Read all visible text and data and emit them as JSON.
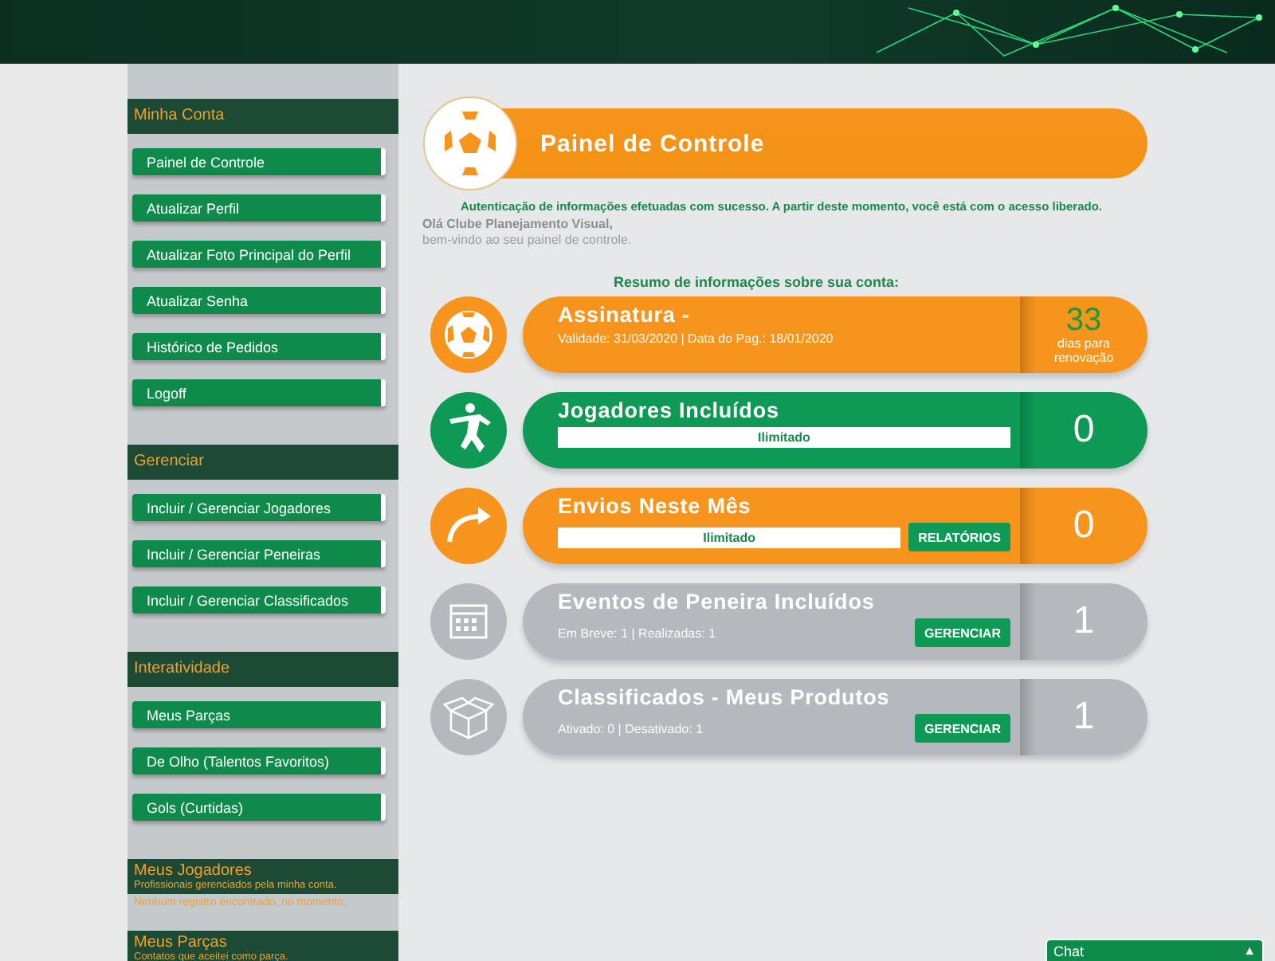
{
  "sidebar": {
    "sections": [
      {
        "heading": "Minha Conta",
        "items": [
          "Painel de Controle",
          "Atualizar Perfil",
          "Atualizar Foto Principal do Perfil",
          "Atualizar Senha",
          "Histórico de Pedidos",
          "Logoff"
        ]
      },
      {
        "heading": "Gerenciar",
        "items": [
          "Incluir / Gerenciar Jogadores",
          "Incluir / Gerenciar Peneiras",
          "Incluir / Gerenciar Classificados"
        ]
      },
      {
        "heading": "Interatividade",
        "items": [
          "Meus Parças",
          "De Olho (Talentos Favoritos)",
          "Gols (Curtidas)"
        ]
      }
    ],
    "panels": [
      {
        "heading": "Meus Jogadores",
        "subtitle": "Profissionais gerenciados pela minha conta.",
        "message": "Nenhum registro encontrado, no momento."
      },
      {
        "heading": "Meus Parças",
        "subtitle": "Contatos que aceitei como parça."
      }
    ]
  },
  "header": {
    "title": "Painel de Controle"
  },
  "success_message": "Autenticação de informações efetuadas com sucesso. A partir deste momento, você está com o acesso liberado.",
  "greeting": "Olá Clube Planejamento Visual,",
  "welcome": "bem-vindo ao seu painel de controle.",
  "summary_title": "Resumo de informações sobre sua conta:",
  "cards": [
    {
      "title": "Assinatura -",
      "color": "#f7941d",
      "info": "Validade: 31/03/2020 | Data do Pag.: 18/01/2020",
      "count": "33",
      "count_note": "dias para renovação"
    },
    {
      "title": "Jogadores Incluídos",
      "color": "#0e9a55",
      "bar_label": "Ilimitado",
      "count": "0"
    },
    {
      "title": "Envios Neste Mês",
      "color": "#f7941d",
      "bar_label": "Ilimitado",
      "button": "RELATÓRIOS",
      "count": "0"
    },
    {
      "title": "Eventos de Peneira Incluídos",
      "color": "#b5b8bc",
      "info": "Em Breve: 1 | Realizadas: 1",
      "button": "GERENCIAR",
      "count": "1"
    },
    {
      "title": "Classificados - Meus Produtos",
      "color": "#b5b8bc",
      "info": "Ativado: 0 | Desativado: 1",
      "button": "GERENCIAR",
      "count": "1"
    }
  ],
  "chat": {
    "label": "Chat",
    "toggle": "▲"
  }
}
